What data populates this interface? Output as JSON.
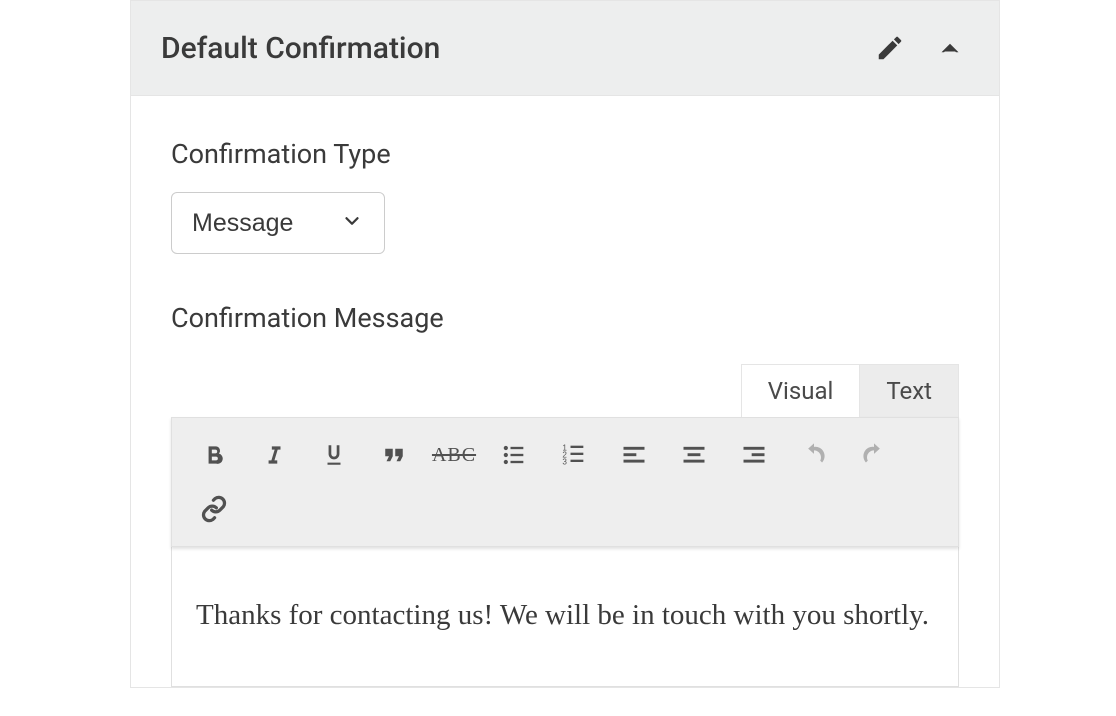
{
  "panel": {
    "title": "Default Confirmation"
  },
  "fields": {
    "type_label": "Confirmation Type",
    "type_value": "Message",
    "message_label": "Confirmation Message"
  },
  "editor": {
    "tabs": {
      "visual": "Visual",
      "text": "Text"
    },
    "content": "Thanks for contacting us! We will be in touch with you shortly.",
    "toolbar": {
      "strike_label": "ABC"
    }
  }
}
